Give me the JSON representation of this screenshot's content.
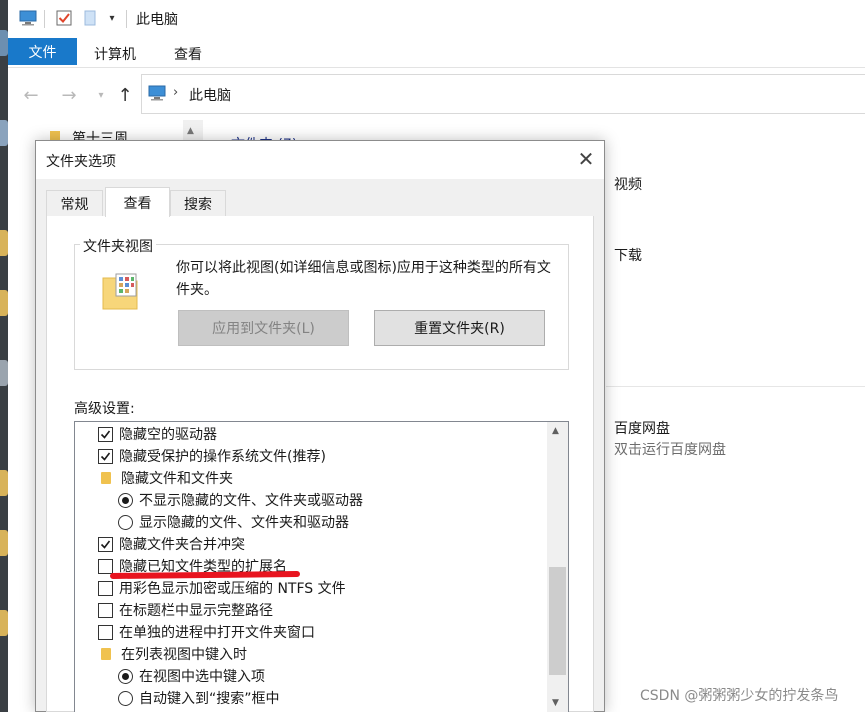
{
  "window": {
    "title": "此电脑"
  },
  "ribbon": {
    "tabs": [
      "文件",
      "计算机",
      "查看"
    ]
  },
  "address": {
    "path": "此电脑"
  },
  "nav": {
    "item": "第十三周"
  },
  "content": {
    "truncated_header": "文件夹 (7)",
    "items": [
      {
        "name": "视频"
      },
      {
        "name": "下载"
      },
      {
        "name": "百度网盘",
        "sub": "双击运行百度网盘"
      }
    ]
  },
  "dialog": {
    "title": "文件夹选项",
    "close_symbol": "✕",
    "tabs": [
      "常规",
      "查看",
      "搜索"
    ],
    "active_tab": "查看",
    "folder_views": {
      "legend": "文件夹视图",
      "description": "你可以将此视图(如详细信息或图标)应用于这种类型的所有文件夹。",
      "apply_button": "应用到文件夹(L)",
      "reset_button": "重置文件夹(R)"
    },
    "advanced_label": "高级设置:",
    "settings": [
      {
        "kind": "checkbox",
        "label": "隐藏空的驱动器",
        "checked": true,
        "indent": 0
      },
      {
        "kind": "checkbox",
        "label": "隐藏受保护的操作系统文件(推荐)",
        "checked": true,
        "indent": 0
      },
      {
        "kind": "folder",
        "label": "隐藏文件和文件夹",
        "indent": 0
      },
      {
        "kind": "radio",
        "label": "不显示隐藏的文件、文件夹或驱动器",
        "checked": true,
        "indent": 1
      },
      {
        "kind": "radio",
        "label": "显示隐藏的文件、文件夹和驱动器",
        "checked": false,
        "indent": 1
      },
      {
        "kind": "checkbox",
        "label": "隐藏文件夹合并冲突",
        "checked": true,
        "indent": 0
      },
      {
        "kind": "checkbox",
        "label": "隐藏已知文件类型的扩展名",
        "checked": false,
        "indent": 0
      },
      {
        "kind": "checkbox",
        "label": "用彩色显示加密或压缩的 NTFS 文件",
        "checked": false,
        "indent": 0
      },
      {
        "kind": "checkbox",
        "label": "在标题栏中显示完整路径",
        "checked": false,
        "indent": 0
      },
      {
        "kind": "checkbox",
        "label": "在单独的进程中打开文件夹窗口",
        "checked": false,
        "indent": 0
      },
      {
        "kind": "folder",
        "label": "在列表视图中键入时",
        "indent": 0
      },
      {
        "kind": "radio",
        "label": "在视图中选中键入项",
        "checked": true,
        "indent": 1
      },
      {
        "kind": "radio",
        "label": "自动键入到“搜索”框中",
        "checked": false,
        "indent": 1
      }
    ]
  },
  "watermark": "CSDN @粥粥粥少女的拧发条鸟",
  "colors": {
    "accent": "#1979ca",
    "annotation": "#e8141f",
    "folder": "#f0c24f"
  }
}
